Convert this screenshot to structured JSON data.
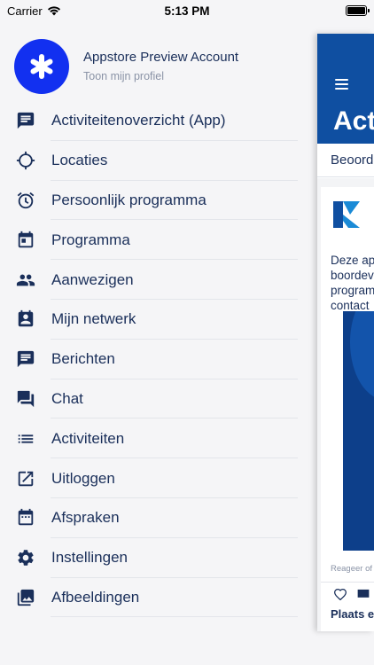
{
  "status_bar": {
    "carrier": "Carrier",
    "time": "5:13 PM"
  },
  "profile": {
    "name": "Appstore Preview Account",
    "subtitle": "Toon mijn profiel"
  },
  "menu": {
    "items": [
      {
        "label": "Activiteitenoverzicht (App)",
        "icon": "message-icon"
      },
      {
        "label": "Locaties",
        "icon": "location-target-icon"
      },
      {
        "label": "Persoonlijk programma",
        "icon": "alarm-clock-icon"
      },
      {
        "label": "Programma",
        "icon": "calendar-icon"
      },
      {
        "label": "Aanwezigen",
        "icon": "people-icon"
      },
      {
        "label": "Mijn netwerk",
        "icon": "contact-card-icon"
      },
      {
        "label": "Berichten",
        "icon": "chat-bubble-icon"
      },
      {
        "label": "Chat",
        "icon": "forum-icon"
      },
      {
        "label": "Activiteiten",
        "icon": "list-icon"
      },
      {
        "label": "Uitloggen",
        "icon": "open-external-icon"
      },
      {
        "label": "Afspraken",
        "icon": "calendar-dots-icon"
      },
      {
        "label": "Instellingen",
        "icon": "gear-icon"
      },
      {
        "label": "Afbeeldingen",
        "icon": "photos-icon"
      }
    ]
  },
  "panel": {
    "title": "Acti",
    "tab": "Beoord",
    "card_text": [
      "Deze ap",
      "boordev",
      "program",
      "contact"
    ],
    "reply": "Reageer of",
    "place": "Plaats e"
  },
  "colors": {
    "accent": "#0f4fa1",
    "avatar": "#1230f0",
    "text": "#1a2f5a",
    "muted": "#8a93a6"
  }
}
